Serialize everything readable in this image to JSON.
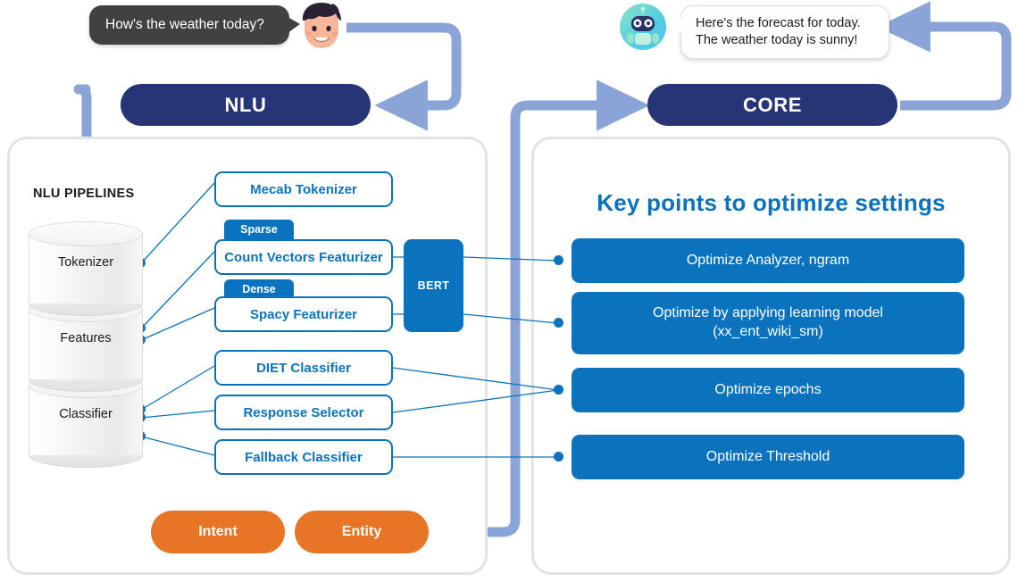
{
  "conversation": {
    "user_bubble": "How's the weather today?",
    "bot_bubble": "Here's the forecast for today.\nThe weather today is sunny!"
  },
  "headers": {
    "nlu": "NLU",
    "core": "CORE"
  },
  "left_panel": {
    "section_label": "NLU PIPELINES",
    "cylinders": [
      {
        "label": "Tokenizer"
      },
      {
        "label": "Features"
      },
      {
        "label": "Classifier"
      }
    ],
    "components": [
      {
        "label": "Mecab Tokenizer"
      },
      {
        "label": "Count Vectors Featurizer",
        "tag": "Sparse"
      },
      {
        "label": "Spacy Featurizer",
        "tag": "Dense"
      },
      {
        "label": "DIET Classifier"
      },
      {
        "label": "Response Selector"
      },
      {
        "label": "Fallback Classifier"
      }
    ],
    "bert": {
      "label": "BERT"
    },
    "outputs": [
      {
        "label": "Intent"
      },
      {
        "label": "Entity"
      }
    ]
  },
  "right_panel": {
    "title": "Key points to optimize settings",
    "items": [
      {
        "label": "Optimize Analyzer, ngram"
      },
      {
        "label": "Optimize by applying learning model\n(xx_ent_wiki_sm)"
      },
      {
        "label": "Optimize epochs"
      },
      {
        "label": "Optimize Threshold"
      }
    ]
  },
  "colors": {
    "navy": "#253575",
    "blue": "#0b73bd",
    "orange": "#e87425",
    "arrow_blue": "#8aa4d8",
    "panel_border": "#e3e3e3",
    "bubble_dark": "#414141"
  }
}
